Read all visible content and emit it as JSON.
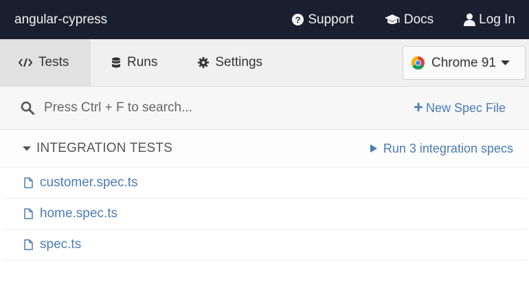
{
  "header": {
    "app_name": "angular-cypress",
    "support_label": "Support",
    "docs_label": "Docs",
    "login_label": "Log In"
  },
  "nav": {
    "tabs": [
      {
        "label": "Tests",
        "icon": "code-icon",
        "active": true
      },
      {
        "label": "Runs",
        "icon": "database-icon",
        "active": false
      },
      {
        "label": "Settings",
        "icon": "gear-icon",
        "active": false
      }
    ],
    "browser": {
      "label": "Chrome 91",
      "icon": "chrome-logo-icon"
    }
  },
  "search": {
    "placeholder": "Press Ctrl + F to search...",
    "new_spec_label": "New Spec File"
  },
  "integration": {
    "title": "INTEGRATION TESTS",
    "run_all_label": "Run 3 integration specs",
    "specs": [
      {
        "name": "customer.spec.ts"
      },
      {
        "name": "home.spec.ts"
      },
      {
        "name": "spec.ts"
      }
    ]
  },
  "colors": {
    "header_bg": "#1b1e2e",
    "link_blue": "#4b7bb4",
    "nav_bg": "#f0f0f0",
    "active_tab_bg": "#e1e1e1"
  }
}
